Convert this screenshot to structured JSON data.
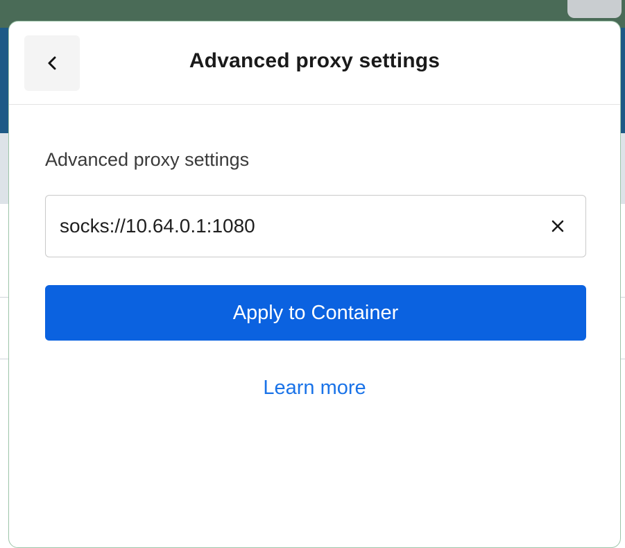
{
  "header": {
    "title": "Advanced proxy settings",
    "back_icon": "chevron-left-icon"
  },
  "form": {
    "section_label": "Advanced proxy settings",
    "proxy_value": "socks://10.64.0.1:1080",
    "clear_icon": "close-icon",
    "apply_label": "Apply to Container"
  },
  "footer": {
    "learn_more_label": "Learn more"
  },
  "colors": {
    "primary": "#0b62e0",
    "link": "#1a73e8",
    "panel_border": "#9cc4a8"
  }
}
